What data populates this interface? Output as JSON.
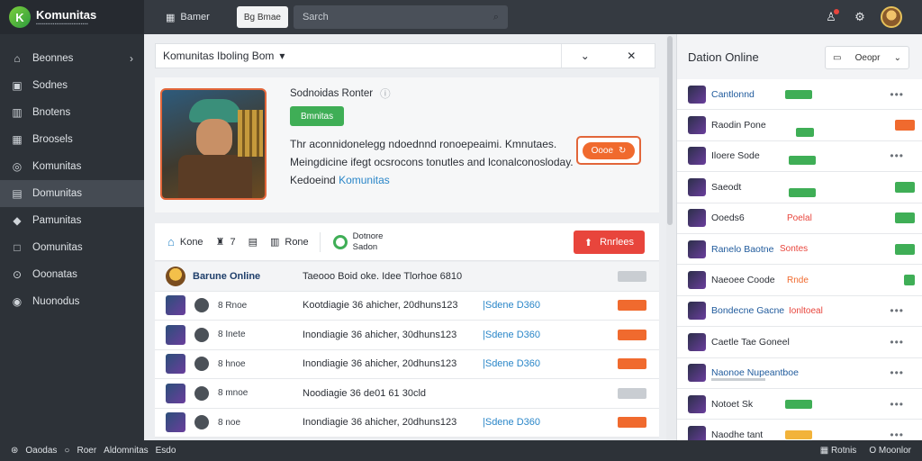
{
  "app": {
    "logo_title": "Komunitas",
    "logo_subtitle": "▪▪▪▪▪▪▪▪▪▪▪▪▪▪▪▪▪▪▪▪▪▪▪▪▪▪▪▪"
  },
  "sidebar": {
    "items": [
      {
        "label": "Beonnes",
        "icon": "home-icon"
      },
      {
        "label": "Sodnes",
        "icon": "screen-icon"
      },
      {
        "label": "Bnotens",
        "icon": "building-icon"
      },
      {
        "label": "Broosels",
        "icon": "grid-icon"
      },
      {
        "label": "Komunitas",
        "icon": "circle-icon"
      },
      {
        "label": "Domunitas",
        "icon": "chart-icon"
      },
      {
        "label": "Pamunitas",
        "icon": "tag-icon"
      },
      {
        "label": "Oomunitas",
        "icon": "square-icon"
      },
      {
        "label": "Ooonatas",
        "icon": "search-icon"
      },
      {
        "label": "Nuonodus",
        "icon": "chat-icon"
      }
    ]
  },
  "topbar": {
    "tab_label": "Bamer",
    "pill_label": "Bg Bmae",
    "search_placeholder": "Sarch"
  },
  "panel": {
    "title": "Komunitas Iboling Bom",
    "game_title": "Sodnoidas Ronter",
    "green_button": "Bmnitas",
    "description": "Thr aconnidonelegg ndoednnd ronoepeaimi. Kmnutaes. Meingdicine ifegt ocsrocons tonutles and lconalconosloday. Kedoeind",
    "description_link": "Komunitas",
    "orange_button": "Oooe"
  },
  "tabs": {
    "t1": "Kone",
    "t2": "7",
    "t3": "Rone",
    "stack_top": "Dotnore",
    "stack_bottom": "Sadon",
    "red_button": "Rnrlees"
  },
  "list": {
    "header": {
      "meta": "Barune Online",
      "info": "Taeooo Boid oke. Idee Tlorhoe 6810"
    },
    "rows": [
      {
        "meta": "8 Rnoe",
        "info": "Kootdiagie 36 ahicher, 20dhuns123",
        "link": "|Sdene D360",
        "pill": "orange"
      },
      {
        "meta": "8 Inete",
        "info": "Inondiagie 36 ahicher, 30dhuns123",
        "link": "|Sdene D360",
        "pill": "orange"
      },
      {
        "meta": "8 hnoe",
        "info": "Inondiagie 36 ahicher, 20dhuns123",
        "link": "|Sdene D360",
        "pill": "orange"
      },
      {
        "meta": "8 mnoe",
        "info": "Noodiagie 36 de01 61 30cld",
        "link": "",
        "pill": "gray"
      },
      {
        "meta": "8 noe",
        "info": "Inondiagie 36 ahicher, 20dhuns123",
        "link": "|Sdene D360",
        "pill": "orange"
      }
    ]
  },
  "right_panel": {
    "title": "Dation Online",
    "select_label": "Oeopr",
    "items": [
      {
        "name": "Cantlonnd",
        "blue": true,
        "tag": "green",
        "corner": ""
      },
      {
        "name": "Raodin Pone",
        "blue": false,
        "tag": "green",
        "corner": "orange"
      },
      {
        "name": "Iloere Sode",
        "blue": false,
        "tag": "green",
        "corner": ""
      },
      {
        "name": "Saeodt",
        "blue": false,
        "tag": "green",
        "corner": "green"
      },
      {
        "name": "Ooeds6",
        "blue": false,
        "tag": "",
        "extra": "Poelal",
        "corner": "green"
      },
      {
        "name": "Ranelo Baotne",
        "blue": true,
        "tag": "",
        "extra": "Sontes",
        "corner": "green"
      },
      {
        "name": "Naeoee Coode",
        "blue": false,
        "tag": "",
        "extra": "Rnde",
        "corner": "green"
      },
      {
        "name": "Bondecne Gacne",
        "blue": true,
        "tag": "",
        "extra": "Ionltoeal",
        "corner": ""
      },
      {
        "name": "Caetle Tae Goneel",
        "blue": false,
        "tag": "",
        "corner": ""
      },
      {
        "name": "Naonoe Nupeantboe",
        "blue": true,
        "tag": "",
        "corner": ""
      },
      {
        "name": "Notoet Sk",
        "blue": false,
        "tag": "green",
        "corner": ""
      },
      {
        "name": "Naodhe tant",
        "blue": false,
        "tag": "yellow",
        "corner": ""
      }
    ]
  },
  "statusbar": {
    "left1": "Oaodas",
    "left2": "Roer",
    "left3": "Aldomnitas",
    "left4": "Esdo",
    "right1": "Rotnis",
    "right2": "O Moonlor"
  },
  "colors": {
    "accent_blue": "#2a86c8",
    "accent_green": "#3fae56",
    "accent_orange": "#f06a2e",
    "accent_red": "#e8453c",
    "sidebar_bg": "#2d3238"
  }
}
